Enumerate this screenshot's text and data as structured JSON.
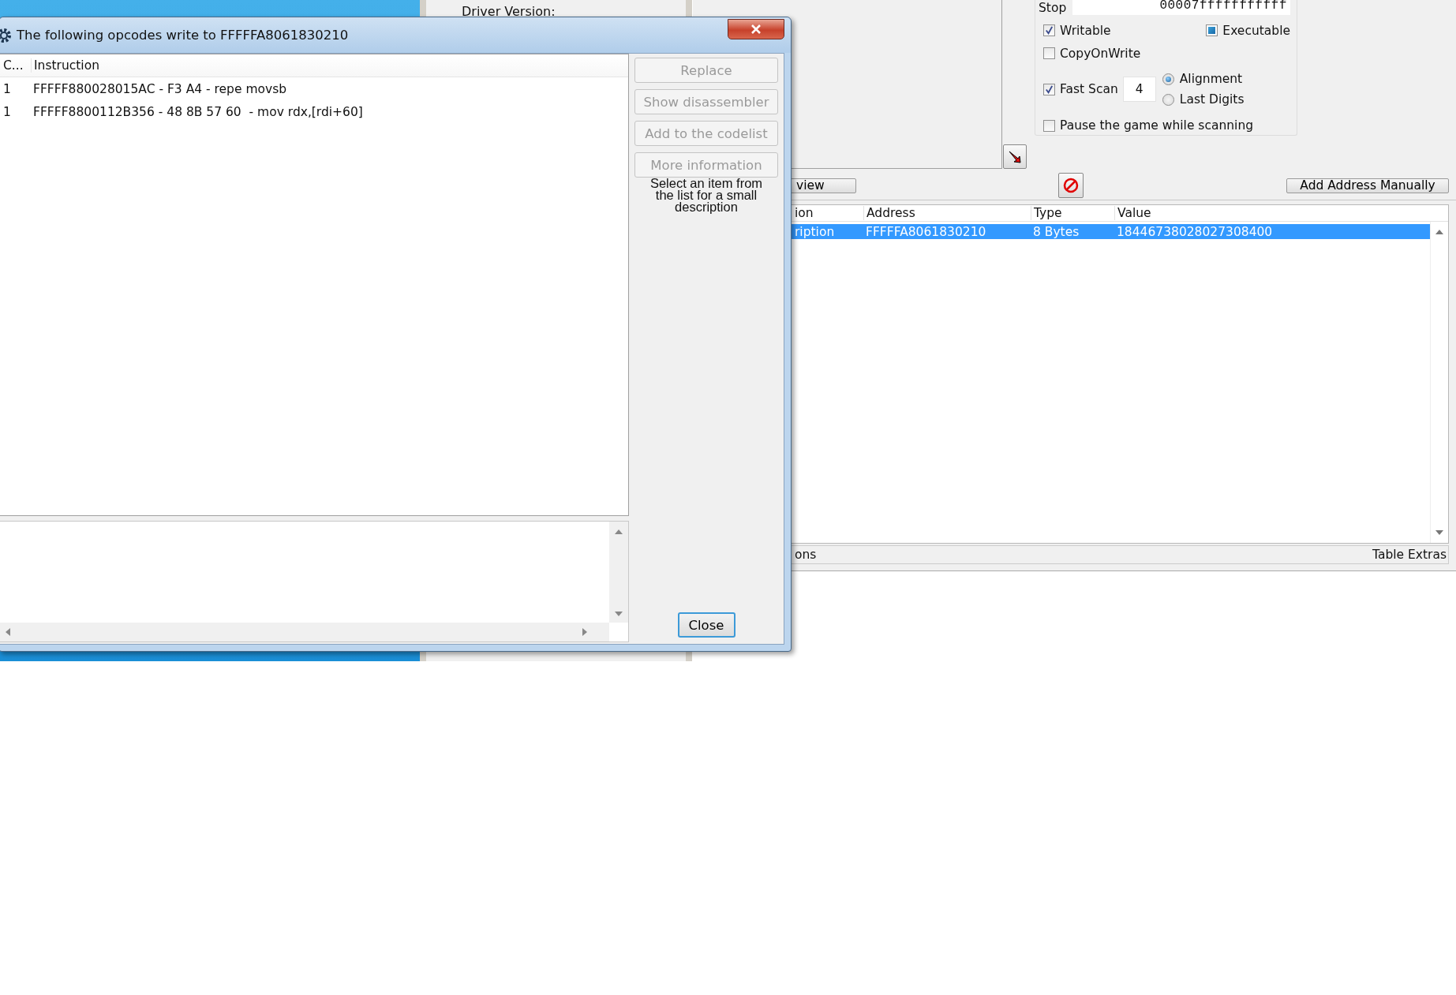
{
  "driver_window": {
    "label": "Driver Version:"
  },
  "main_window": {
    "stop": {
      "label": "Stop",
      "value": "00007fffffffffff"
    },
    "writable": {
      "label": "Writable",
      "checked": true
    },
    "executable": {
      "label": "Executable",
      "indeterminate": true
    },
    "copy_on_write": {
      "label": "CopyOnWrite",
      "checked": false
    },
    "fast_scan": {
      "label": "Fast Scan",
      "checked": true,
      "value": "4"
    },
    "scan_alignment": [
      {
        "label": "Alignment",
        "selected": true
      },
      {
        "label": "Last Digits",
        "selected": false
      }
    ],
    "pause": {
      "label": "Pause the game while scanning",
      "checked": false
    },
    "view_button": "view",
    "add_button": "Add Address Manually",
    "address_list": {
      "columns": [
        "ion",
        "Address",
        "Type",
        "Value"
      ],
      "rows": [
        {
          "cells": [
            "ription",
            "FFFFFA8061830210",
            "8 Bytes",
            "18446738028027308400"
          ],
          "selected": true
        }
      ]
    },
    "footer": [
      "ons",
      "Table Extras"
    ]
  },
  "dialog": {
    "title": "The following opcodes write to FFFFFA8061830210",
    "columns": [
      "C...",
      "Instruction"
    ],
    "rows": [
      {
        "count": "1",
        "instruction": "FFFFF880028015AC - F3 A4 - repe movsb"
      },
      {
        "count": "1",
        "instruction": "FFFFF8800112B356 - 48 8B 57 60  - mov rdx,[rdi+60]"
      }
    ],
    "buttons": [
      {
        "label": "Replace",
        "disabled": true
      },
      {
        "label": "Show disassembler",
        "disabled": true
      },
      {
        "label": "Add to the codelist",
        "disabled": true
      },
      {
        "label": "More information",
        "disabled": true
      }
    ],
    "description": "Select an item from the list for a small description",
    "close_button": "Close"
  }
}
